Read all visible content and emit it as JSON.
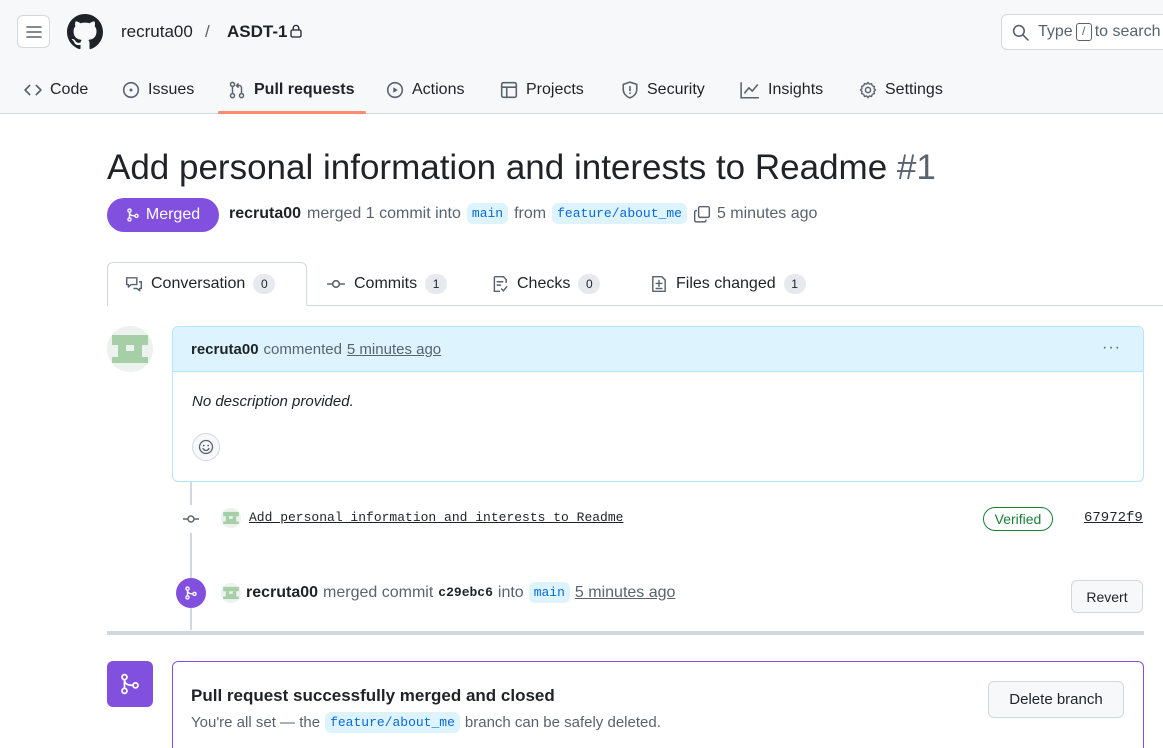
{
  "header": {
    "owner": "recruta00",
    "separator": "/",
    "repo": "ASDT-1",
    "search_prefix": "Type",
    "search_key": "/",
    "search_suffix": "to search"
  },
  "nav": {
    "items": [
      {
        "label": "Code",
        "icon": "code-icon"
      },
      {
        "label": "Issues",
        "icon": "issue-icon"
      },
      {
        "label": "Pull requests",
        "icon": "pull-request-icon"
      },
      {
        "label": "Actions",
        "icon": "play-icon"
      },
      {
        "label": "Projects",
        "icon": "table-icon"
      },
      {
        "label": "Security",
        "icon": "shield-icon"
      },
      {
        "label": "Insights",
        "icon": "graph-icon"
      },
      {
        "label": "Settings",
        "icon": "gear-icon"
      }
    ],
    "active": "Pull requests"
  },
  "pr": {
    "title": "Add personal information and interests to Readme",
    "number": "#1",
    "state": "Merged",
    "author": "recruta00",
    "merged_text": "merged 1 commit into",
    "base_branch": "main",
    "from_text": "from",
    "head_branch": "feature/about_me",
    "time": "5 minutes ago"
  },
  "tabs": [
    {
      "label": "Conversation",
      "count": "0"
    },
    {
      "label": "Commits",
      "count": "1"
    },
    {
      "label": "Checks",
      "count": "0"
    },
    {
      "label": "Files changed",
      "count": "1"
    }
  ],
  "comment": {
    "author": "recruta00",
    "action": "commented",
    "time": "5 minutes ago",
    "menu": "···",
    "body": "No description provided."
  },
  "commit": {
    "message": "Add personal information and interests to Readme",
    "badge": "Verified",
    "sha": "67972f9"
  },
  "merge_event": {
    "author": "recruta00",
    "text": "merged commit",
    "sha": "c29ebc6",
    "into_text": "into",
    "branch": "main",
    "time": "5 minutes ago",
    "revert_label": "Revert"
  },
  "merged_box": {
    "title": "Pull request successfully merged and closed",
    "sub_prefix": "You're all set — the",
    "branch": "feature/about_me",
    "sub_suffix": "branch can be safely deleted.",
    "delete_label": "Delete branch"
  },
  "colors": {
    "merged_purple": "#8250df",
    "link_blue": "#0969da",
    "verified_green": "#1a7f37",
    "nav_underline": "#fd8c73"
  }
}
